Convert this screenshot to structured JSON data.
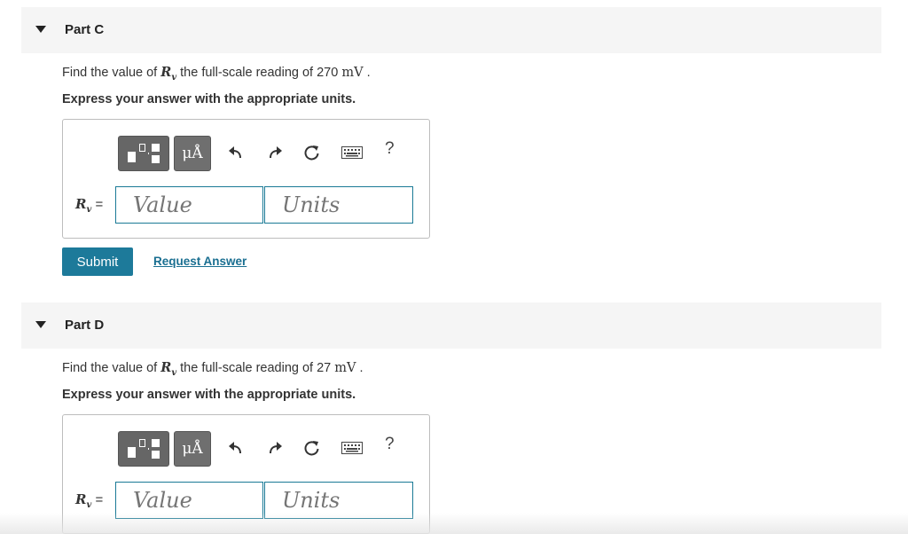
{
  "parts": [
    {
      "title": "Part C",
      "prompt_prefix": "Find the value of ",
      "variable": "R",
      "variable_sub": "v",
      "prompt_middle": " the full-scale reading of 270 ",
      "unit": "mV",
      "prompt_suffix": " .",
      "instruction": "Express your answer with the appropriate units.",
      "units_symbol": "μÅ",
      "help": "?",
      "label_suffix": " =",
      "value_placeholder": "Value",
      "units_placeholder": "Units",
      "submit_label": "Submit",
      "request_label": "Request Answer"
    },
    {
      "title": "Part D",
      "prompt_prefix": "Find the value of ",
      "variable": "R",
      "variable_sub": "v",
      "prompt_middle": " the full-scale reading of 27 ",
      "unit": "mV",
      "prompt_suffix": " .",
      "instruction": "Express your answer with the appropriate units.",
      "units_symbol": "μÅ",
      "help": "?",
      "label_suffix": " =",
      "value_placeholder": "Value",
      "units_placeholder": "Units"
    }
  ],
  "icons": [
    "caret-down-icon",
    "templates-icon",
    "undo-icon",
    "redo-icon",
    "reset-icon",
    "keyboard-icon",
    "help-icon"
  ]
}
